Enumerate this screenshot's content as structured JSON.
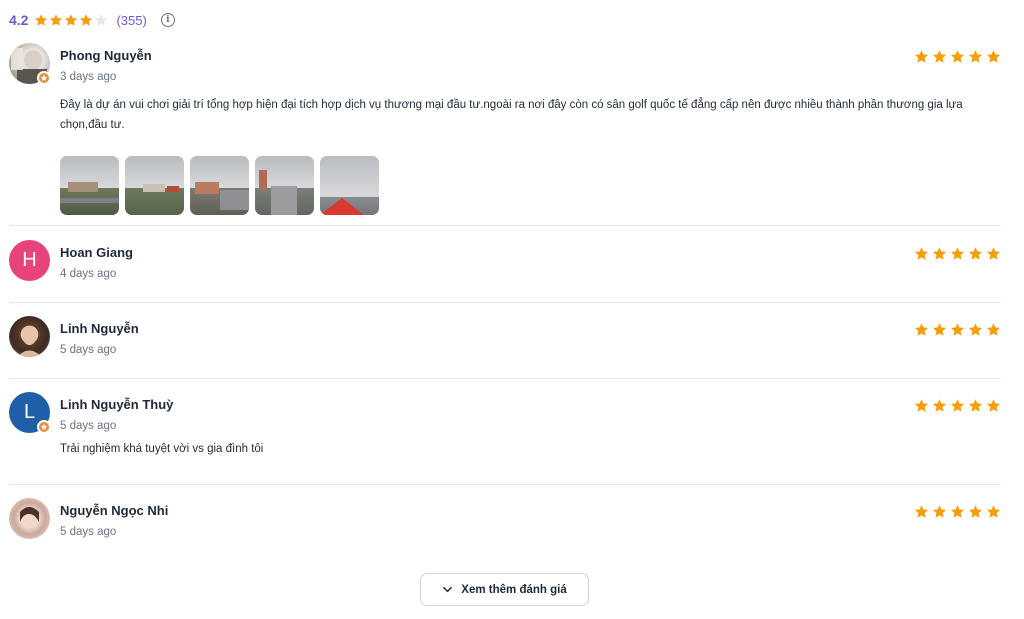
{
  "summary": {
    "score": "4.2",
    "rating": 4.2,
    "count": "(355)",
    "info_icon": "info-icon"
  },
  "colors": {
    "star_filled": "#f59e0b",
    "star_empty": "#e5e7eb",
    "accent": "#6d5bd0",
    "badge": "#f08c3a"
  },
  "reviews": [
    {
      "name": "Phong Nguyễn",
      "date": "3 days ago",
      "rating": 5,
      "text": "Đây là dự án vui chơi giải trí tổng hợp hiện đại tích hợp dịch vụ thương mại đầu tư.ngoài ra nơi đây còn có sân golf quốc tế đẳng cấp nên được nhiều thành phần thương gia lựa chọn,đầu tư.",
      "avatar": "photo",
      "local_guide_badge": true,
      "photos": 5
    },
    {
      "name": "Hoan Giang",
      "date": "4 days ago",
      "rating": 5,
      "text": "",
      "avatar_letter": "H",
      "avatar_color": "#e8437a",
      "local_guide_badge": false
    },
    {
      "name": "Linh Nguyễn",
      "date": "5 days ago",
      "rating": 5,
      "text": "",
      "avatar": "photo",
      "local_guide_badge": false
    },
    {
      "name": "Linh Nguyễn Thuỳ",
      "date": "5 days ago",
      "rating": 5,
      "text": "Trải nghiệm khá tuyệt vời vs gia đình tôi",
      "avatar_letter": "L",
      "avatar_color": "#1f5fa8",
      "local_guide_badge": true
    },
    {
      "name": "Nguyễn Ngọc Nhi",
      "date": "5 days ago",
      "rating": 5,
      "text": "",
      "avatar": "photo",
      "local_guide_badge": false
    }
  ],
  "more_button": {
    "label": "Xem thêm đánh giá",
    "icon": "chevron-down-icon"
  }
}
